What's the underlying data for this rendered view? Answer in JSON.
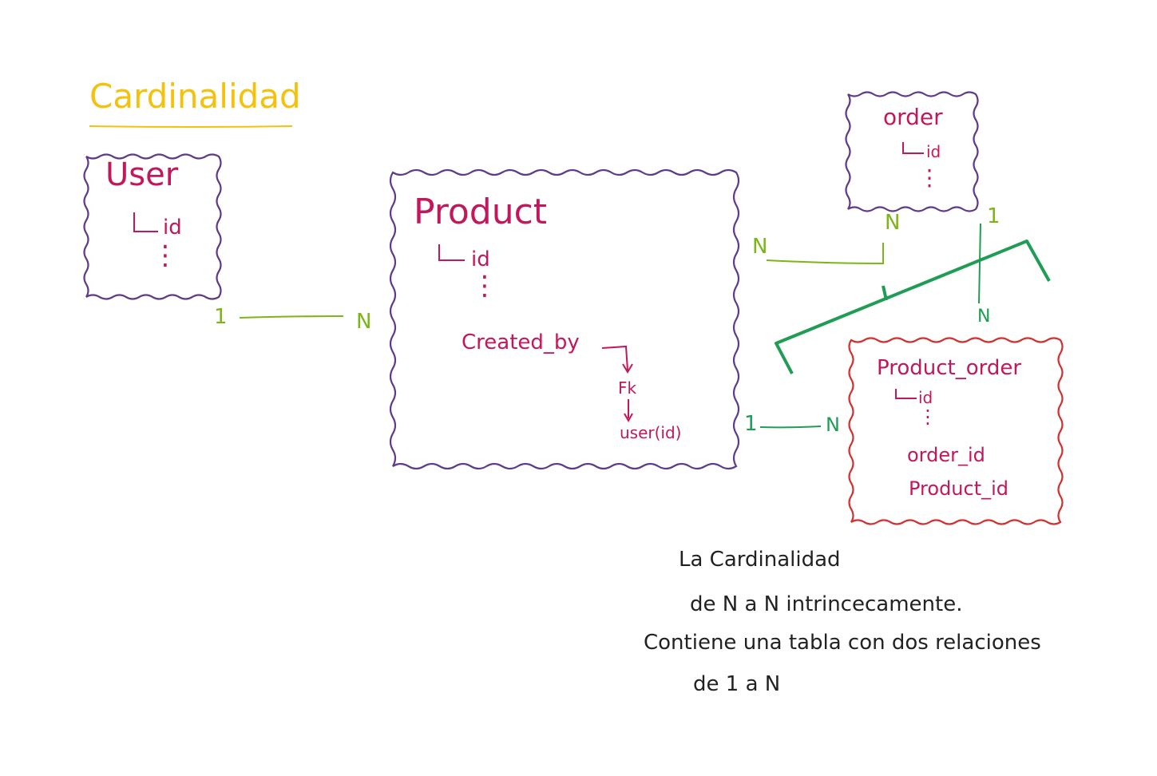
{
  "title": "Cardinalidad",
  "entities": {
    "user": {
      "name": "User",
      "fields": [
        "id",
        "⋮"
      ]
    },
    "product": {
      "name": "Product",
      "fields": [
        "id",
        "⋮",
        "Created_by"
      ],
      "fk_label": "Fk",
      "fk_ref": "user(id)"
    },
    "order": {
      "name": "order",
      "fields": [
        "id",
        "⋮"
      ]
    },
    "product_order": {
      "name": "Product_order",
      "fields": [
        "id",
        "⋮",
        "order_id",
        "Product_id"
      ]
    }
  },
  "cardinalities": {
    "user_product": {
      "left": "1",
      "right": "N"
    },
    "product_order": {
      "left": "N",
      "right": "N"
    },
    "order_side": "1",
    "junction_top": "N",
    "product_junction": {
      "left": "1",
      "right": "N"
    }
  },
  "note": {
    "line1": "La Cardinalidad",
    "line2": "de N a N intrincecamente.",
    "line3": "Contiene una tabla con dos relaciones",
    "line4": "de 1 a N"
  },
  "colors": {
    "title": "#f4c20d",
    "entity_border": "#5e3a8c",
    "junction_border": "#d32f2f",
    "text": "#c2185b",
    "relation_light": "#7cb518",
    "relation_dark": "#1f9d55"
  }
}
